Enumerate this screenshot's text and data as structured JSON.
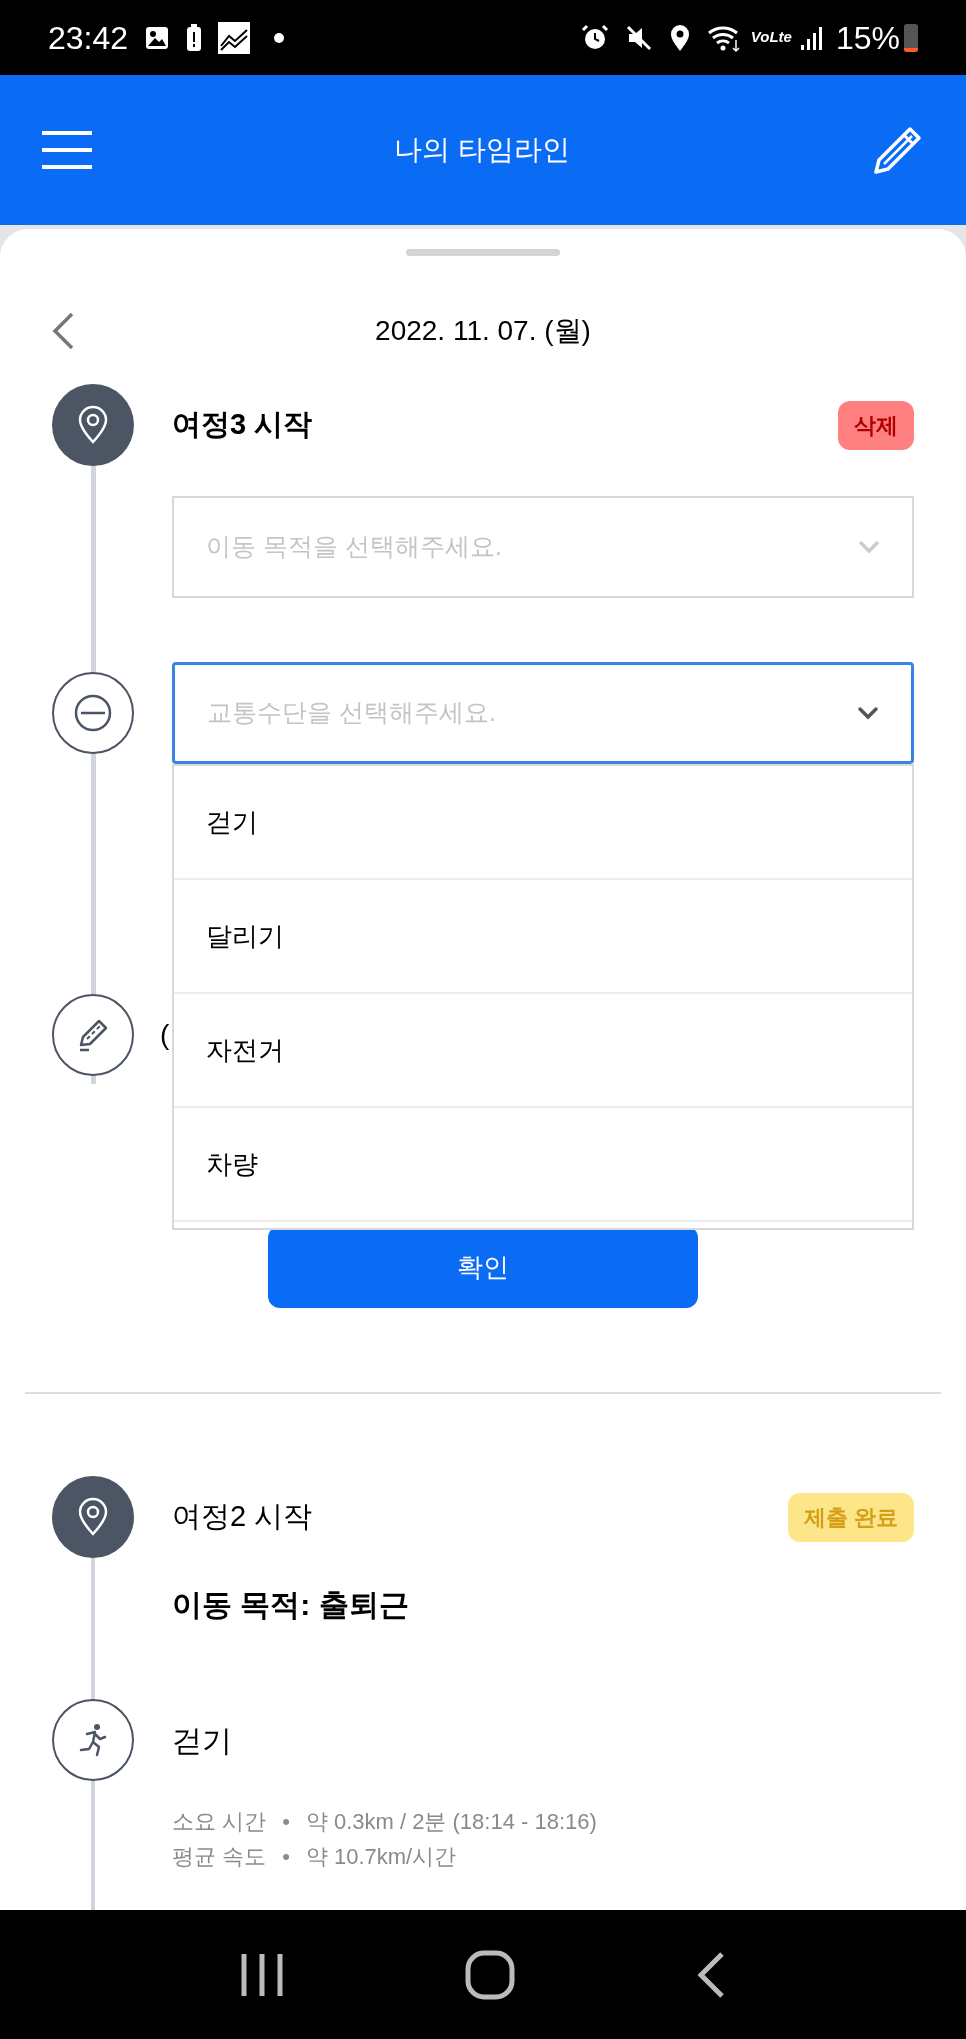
{
  "status_bar": {
    "time": "23:42",
    "network": "VoLte",
    "battery": "15%"
  },
  "app_bar": {
    "title": "나의 타임라인"
  },
  "date": "2022. 11. 07. (월)",
  "editor": {
    "title": "여정3 시작",
    "badge": {
      "text": "삭제",
      "kind": "delete"
    },
    "purpose_select": {
      "placeholder": "이동 목적을 선택해주세요.",
      "focused": false
    },
    "transport_select": {
      "placeholder": "교통수단을 선택해주세요.",
      "focused": true,
      "expanded": true,
      "options": [
        {
          "label": "걷기",
          "selected": false
        },
        {
          "label": "달리기",
          "selected": false
        },
        {
          "label": "자전거",
          "selected": false
        },
        {
          "label": "차량",
          "selected": false
        }
      ]
    },
    "memo_label": "(",
    "confirm": "확인"
  },
  "history": {
    "title": "여정2 시작",
    "badge": {
      "text": "제출 완료",
      "kind": "submitted"
    },
    "purpose": "이동 목적: 출퇴근",
    "mode": "걷기",
    "details": [
      {
        "label": "소요 시간",
        "separator": "•",
        "value": "약 0.3km / 2분 (18:14 - 18:16)"
      },
      {
        "label": "평균 속도",
        "separator": "•",
        "value": "약 10.7km/시간"
      }
    ]
  }
}
